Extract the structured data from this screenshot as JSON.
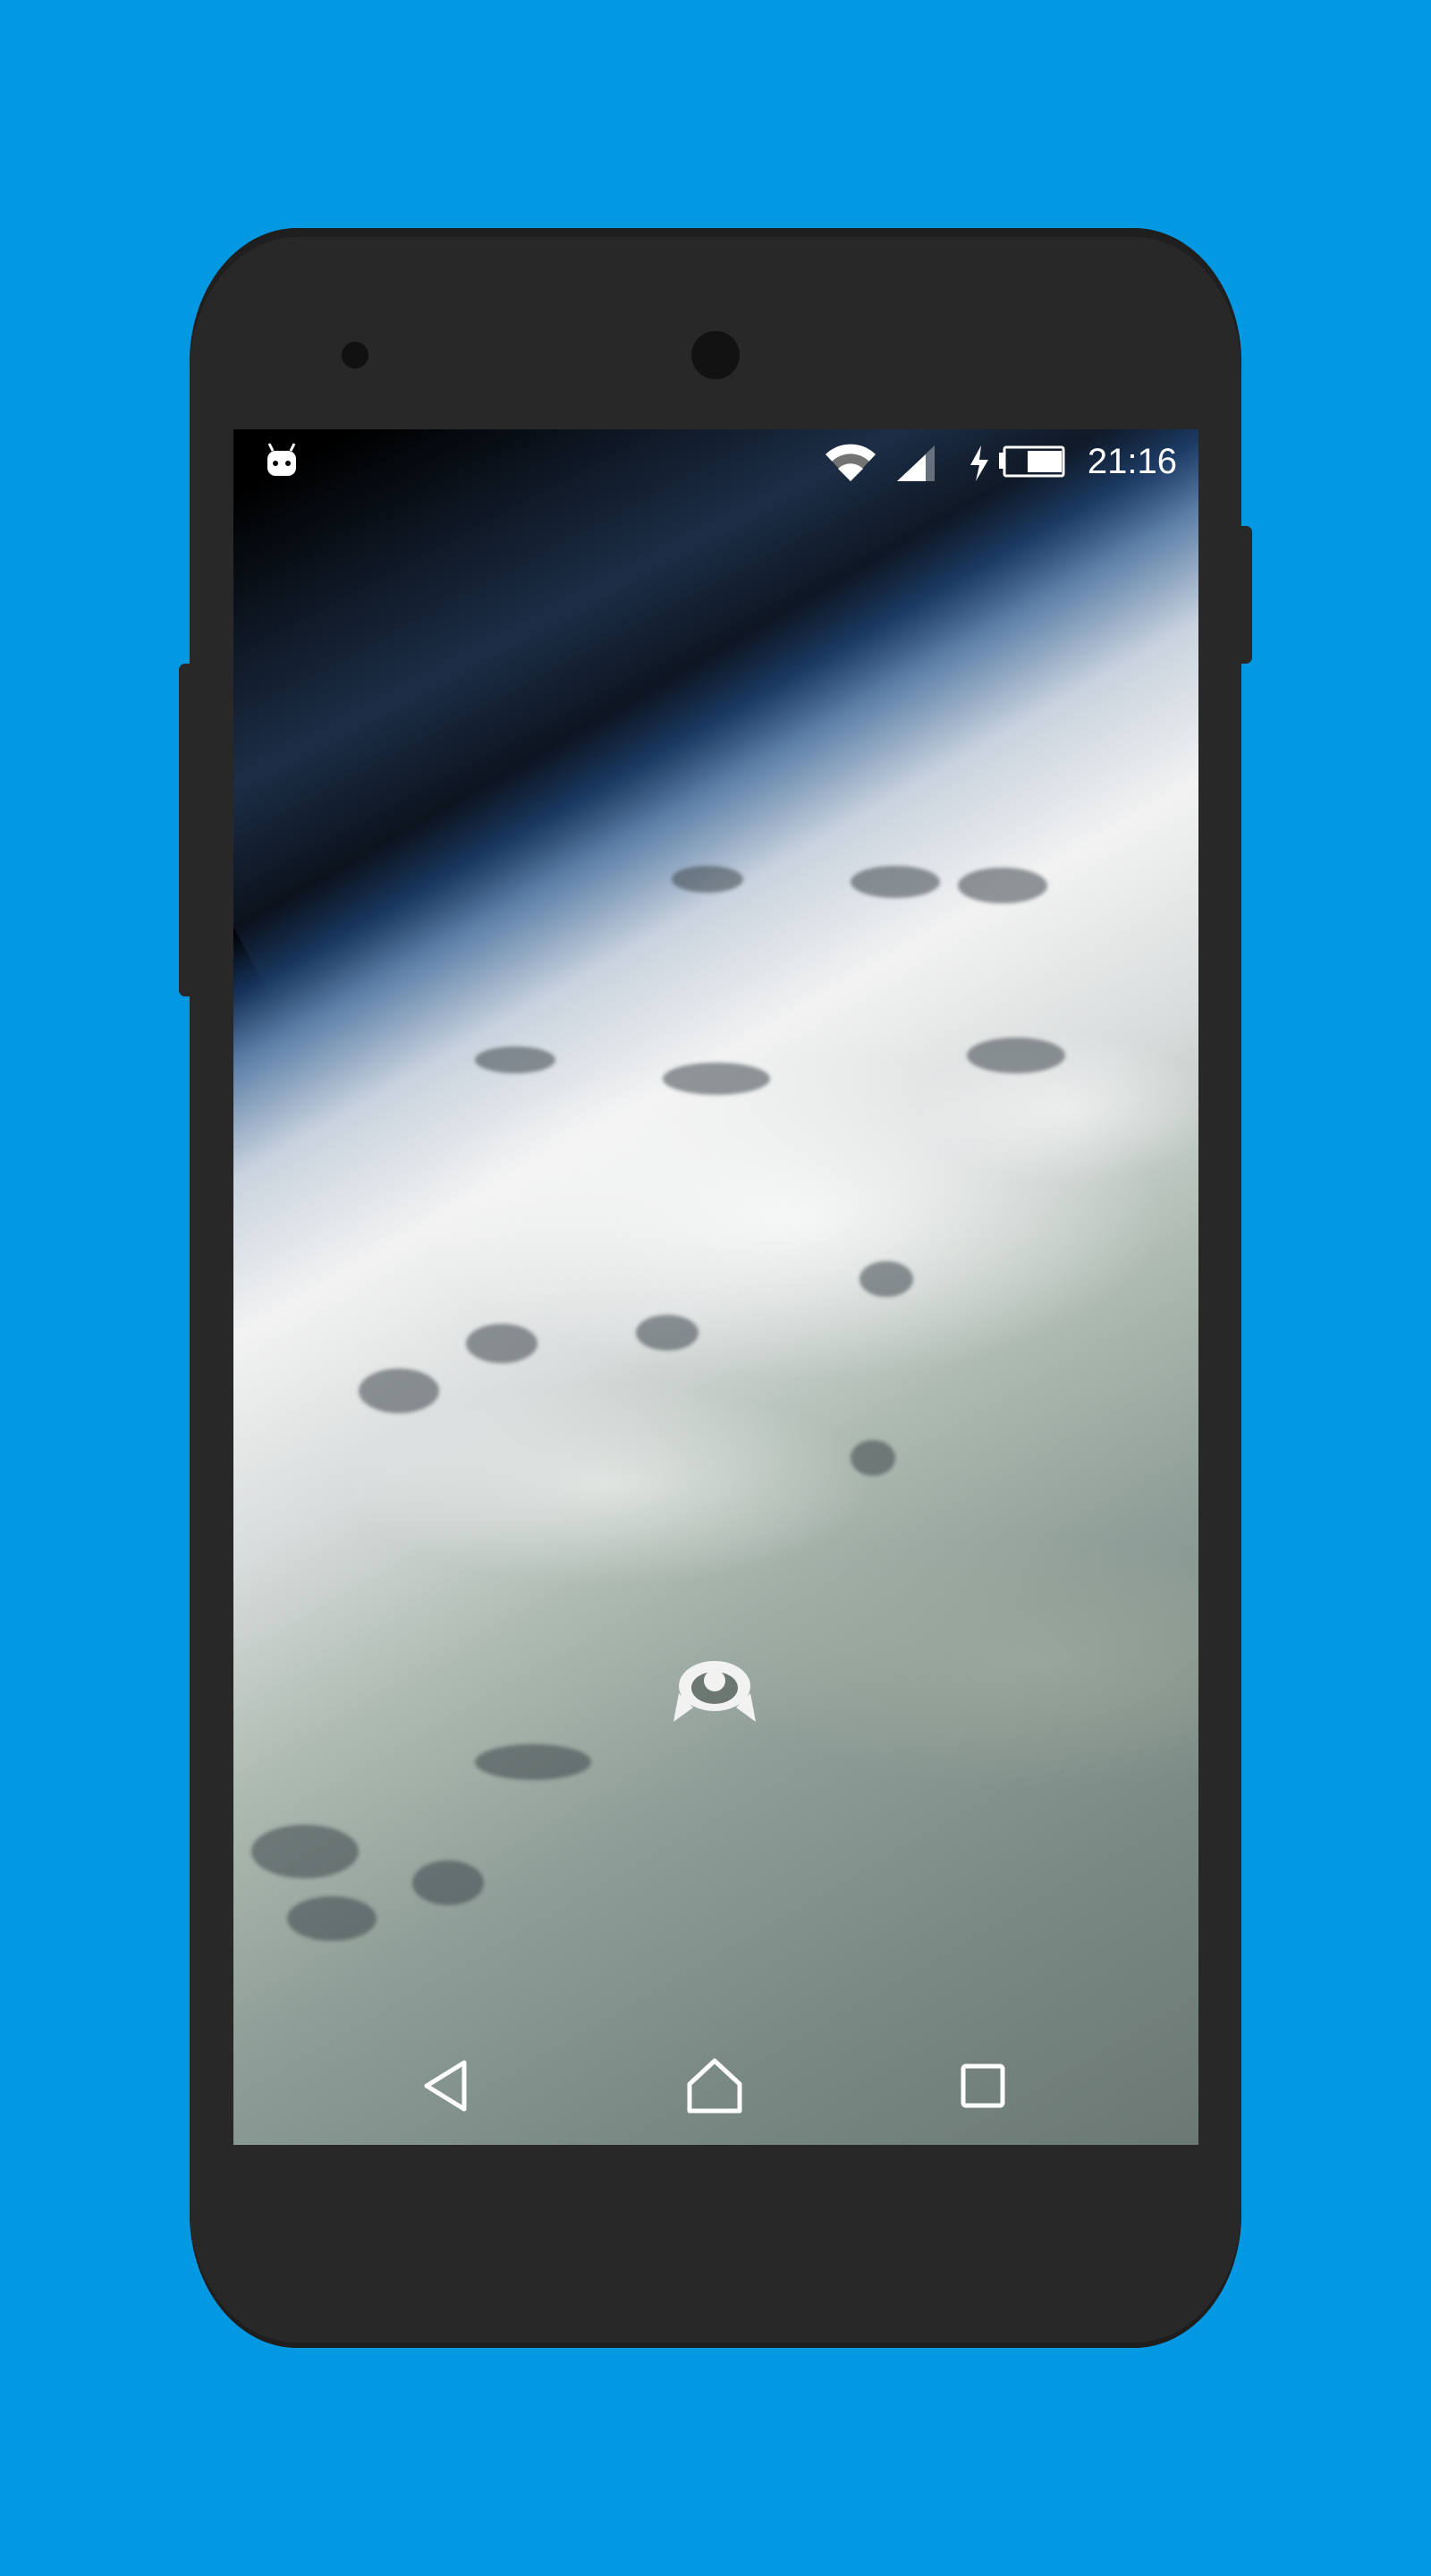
{
  "colors": {
    "background": "#0398e2",
    "device_body": "#282828",
    "icon_color": "#ffffff"
  },
  "status_bar": {
    "notification_icon": "android-debug-icon",
    "wifi_icon": "wifi-icon",
    "signal_icon": "cell-signal-icon",
    "charging_icon": "battery-charging-icon",
    "time": "21:16"
  },
  "wallpaper": {
    "description_icon": "earth-from-space-wallpaper"
  },
  "center_logo": {
    "icon": "app-logo-icon"
  },
  "nav_bar": {
    "back_icon": "back-icon",
    "home_icon": "home-icon",
    "recents_icon": "recents-icon"
  }
}
